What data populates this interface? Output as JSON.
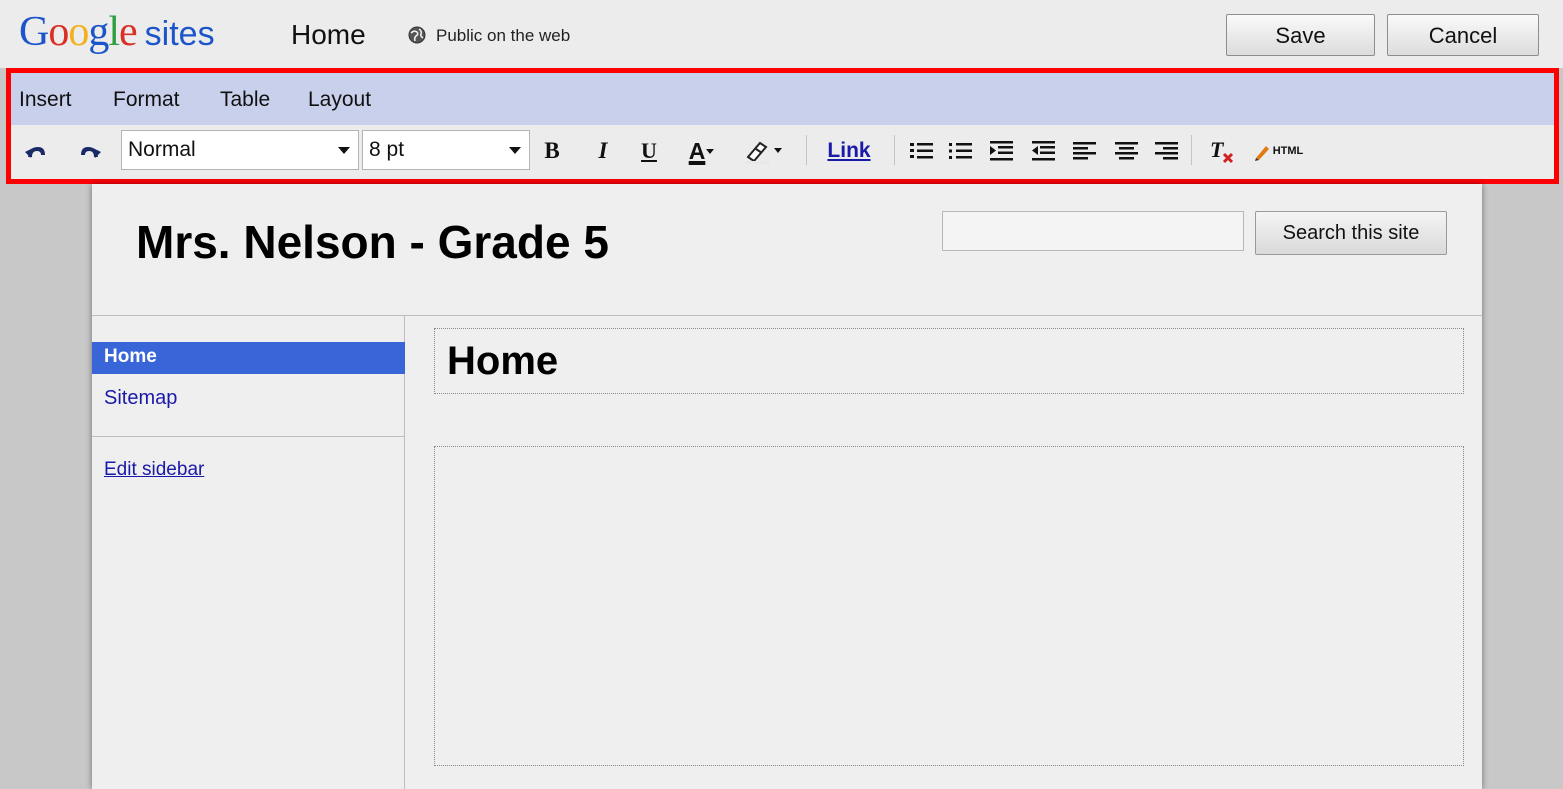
{
  "header": {
    "logo_letters": [
      "G",
      "o",
      "o",
      "g",
      "l",
      "e"
    ],
    "logo_suffix": "sites",
    "page_name": "Home",
    "visibility_icon": "globe-icon",
    "visibility": "Public on the web",
    "save_label": "Save",
    "cancel_label": "Cancel"
  },
  "editor": {
    "menu": [
      "Insert",
      "Format",
      "Table",
      "Layout"
    ],
    "style_select": "Normal",
    "size_select": "8 pt",
    "tools": {
      "undo": "undo-icon",
      "redo": "redo-icon",
      "bold": "B",
      "italic": "I",
      "underline": "U",
      "text_color": "A",
      "link": "Link",
      "html": "HTML"
    }
  },
  "site": {
    "title": "Mrs. Nelson - Grade 5",
    "search_button": "Search this site",
    "search_value": ""
  },
  "sidebar": {
    "items": [
      {
        "label": "Home",
        "selected": true
      },
      {
        "label": "Sitemap",
        "selected": false
      }
    ],
    "edit_label": "Edit sidebar"
  },
  "content": {
    "heading": "Home"
  },
  "colors": {
    "highlight": "#ff0000",
    "menubar": "#c8d0ec",
    "nav_selected": "#3865d8",
    "link": "#1a1aa8"
  }
}
